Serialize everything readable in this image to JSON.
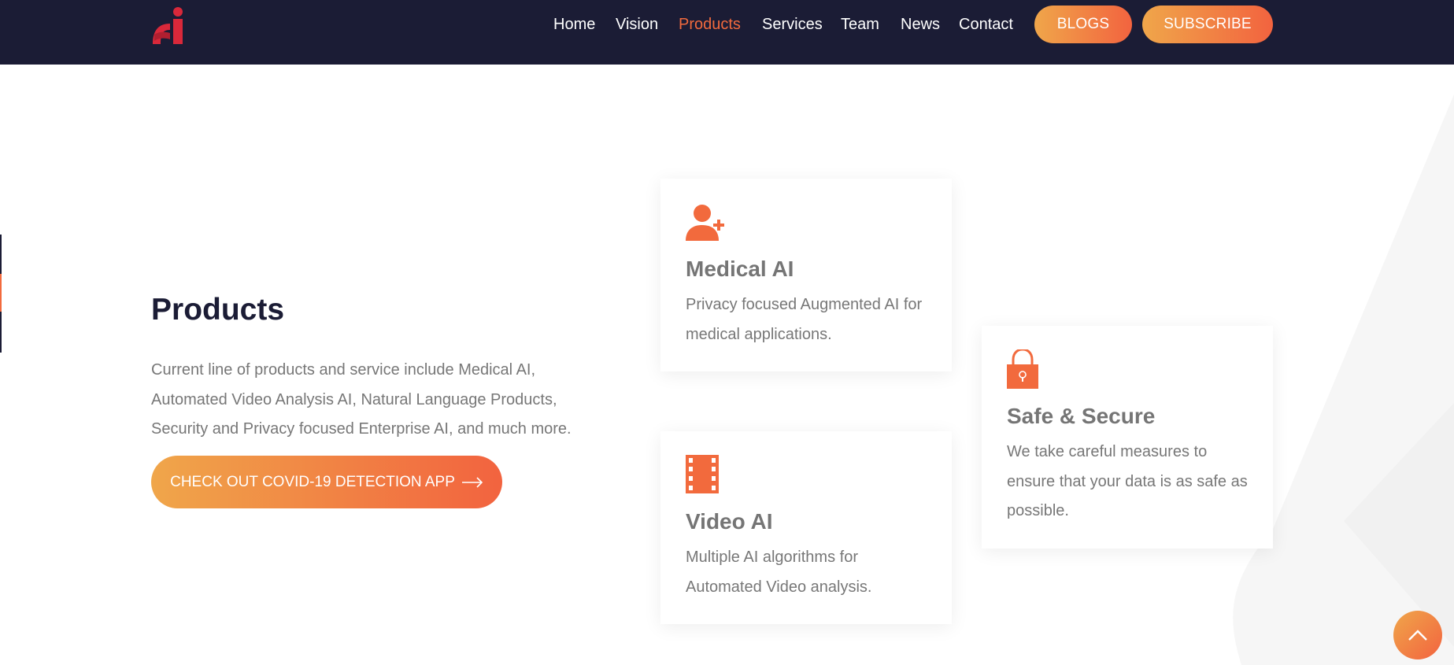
{
  "nav": {
    "items": [
      "Home",
      "Vision",
      "Products",
      "Services",
      "Team",
      "News",
      "Contact"
    ],
    "active": "Products",
    "blogs_label": "BLOGS",
    "subscribe_label": "SUBSCRIBE"
  },
  "products": {
    "title": "Products",
    "description": "Current line of products and service include Medical AI, Automated Video Analysis AI, Natural Language Products, Security and Privacy focused Enterprise AI, and much more.",
    "cta_label": "CHECK OUT COVID-19 DETECTION APP"
  },
  "cards": [
    {
      "icon": "medical-user-plus-icon",
      "title": "Medical AI",
      "text": "Privacy focused Augmented AI for medical applications."
    },
    {
      "icon": "film-strip-icon",
      "title": "Video AI",
      "text": "Multiple AI algorithms for Automated Video analysis."
    },
    {
      "icon": "padlock-icon",
      "title": "Safe & Secure",
      "text": "We take careful measures to ensure that your data is as safe as possible."
    }
  ],
  "colors": {
    "header_bg": "#1b1c35",
    "accent": "#f26a3d",
    "gradient_start": "#f0a64a",
    "gradient_end": "#f2633f"
  }
}
